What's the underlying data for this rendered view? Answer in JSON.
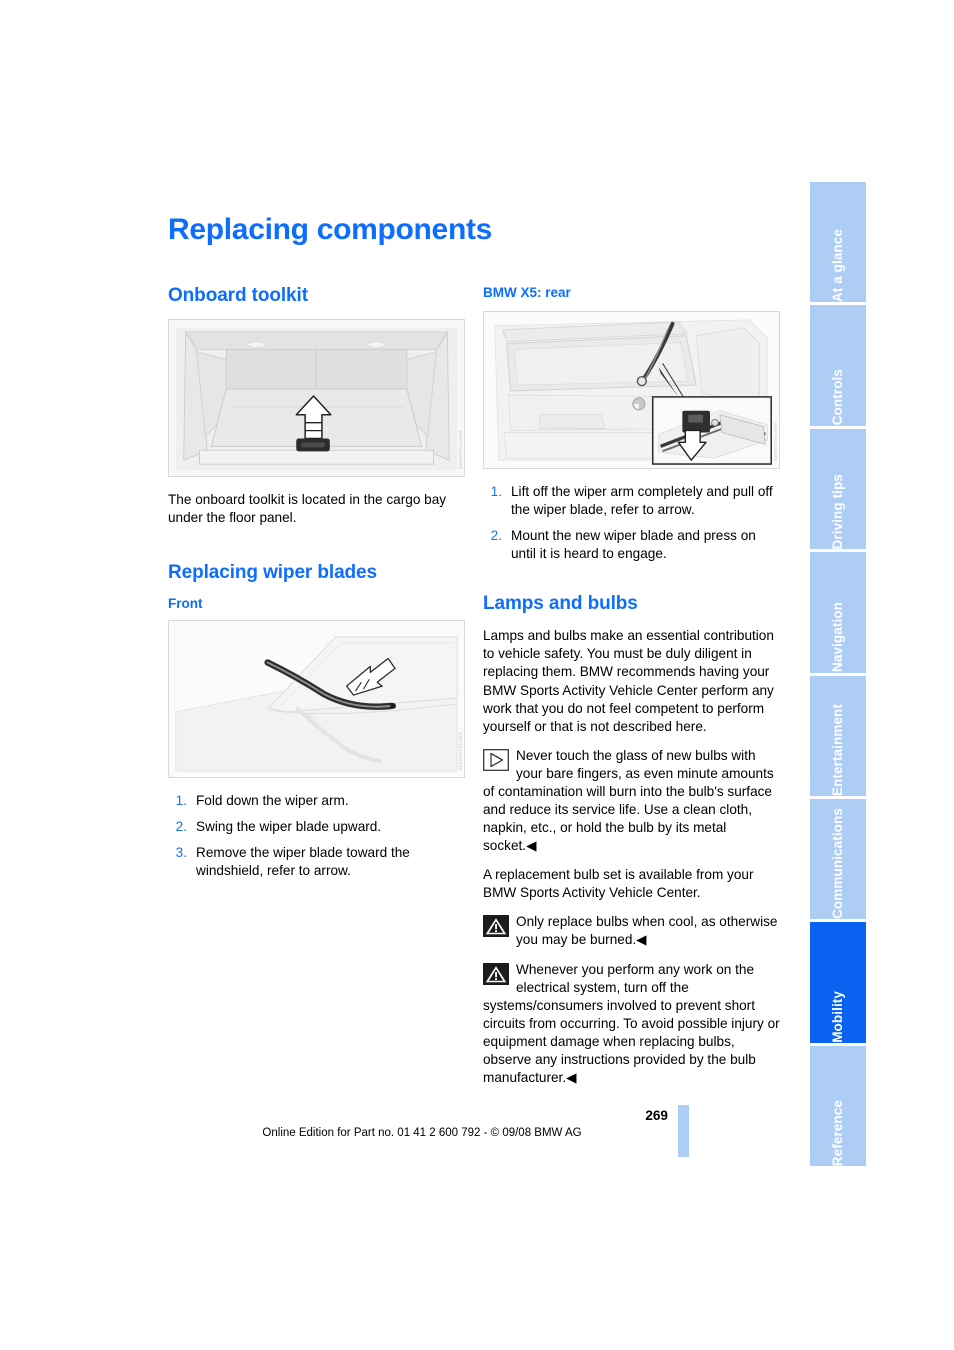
{
  "document": {
    "title": "Replacing components",
    "page_number": "269",
    "footer_line": "Online Edition for Part no. 01 41 2 600 792 - © 09/08 BMW AG",
    "accent_color": "#0d6efd",
    "tab_inactive_color": "#aecdf5",
    "tab_active_color": "#0a62f0"
  },
  "tabs": [
    {
      "label": "At a glance",
      "active": false
    },
    {
      "label": "Controls",
      "active": false
    },
    {
      "label": "Driving tips",
      "active": false
    },
    {
      "label": "Navigation",
      "active": false
    },
    {
      "label": "Entertainment",
      "active": false
    },
    {
      "label": "Communications",
      "active": false
    },
    {
      "label": "Mobility",
      "active": true
    },
    {
      "label": "Reference",
      "active": false
    }
  ],
  "left_column": {
    "section_onboard_toolkit": {
      "heading": "Onboard toolkit",
      "figure": {
        "name": "cargo-bay-floor-panel-illustration",
        "alt": "Cargo bay with floor panel and upward arrow"
      },
      "paragraph": "The onboard toolkit is located in the cargo bay under the floor panel."
    },
    "section_replacing_wiper_blades": {
      "heading": "Replacing wiper blades",
      "subheading": "Front",
      "figure": {
        "name": "front-windshield-wiper-illustration",
        "alt": "Windshield with wiper blade and direction arrow"
      },
      "steps": [
        {
          "num": "1.",
          "text": "Fold down the wiper arm."
        },
        {
          "num": "2.",
          "text": "Swing the wiper blade upward."
        },
        {
          "num": "3.",
          "text": "Remove the wiper blade toward the windshield, refer to arrow."
        }
      ]
    }
  },
  "right_column": {
    "section_bmw_x5_rear": {
      "heading": "BMW X5: rear",
      "figure": {
        "name": "bmw-x5-rear-wiper-illustration",
        "alt": "BMW X5 rear hatch with wiper arm and detail inset"
      },
      "steps": [
        {
          "num": "1.",
          "text": "Lift off the wiper arm completely and pull off the wiper blade, refer to arrow."
        },
        {
          "num": "2.",
          "text": "Mount the new wiper blade and press on until it is heard to engage."
        }
      ]
    },
    "section_lamps_and_bulbs": {
      "heading": "Lamps and bulbs",
      "intro": "Lamps and bulbs make an essential contribution to vehicle safety. You must be duly diligent in replacing them. BMW recommends having your BMW Sports Activity Vehicle Center perform any work that you do not feel competent to perform yourself or that is not described here.",
      "note": {
        "icon": "note-triangle-icon",
        "text": "Never touch the glass of new bulbs with your bare fingers, as even minute amounts of contamination will burn into the bulb's surface and reduce its service life. Use a clean cloth, napkin, etc., or hold the bulb by its metal socket.◀"
      },
      "replacement_paragraph": "A replacement bulb set is available from your BMW Sports Activity Vehicle Center.",
      "warnings": [
        {
          "icon": "warning-triangle-icon",
          "text": "Only replace bulbs when cool, as otherwise you may be burned.◀"
        },
        {
          "icon": "warning-triangle-icon",
          "text": "Whenever you perform any work on the electrical system, turn off the systems/consumers involved to prevent short circuits from occurring. To avoid possible injury or equipment damage when replacing bulbs, observe any instructions provided by the bulb manufacturer.◀"
        }
      ]
    }
  }
}
